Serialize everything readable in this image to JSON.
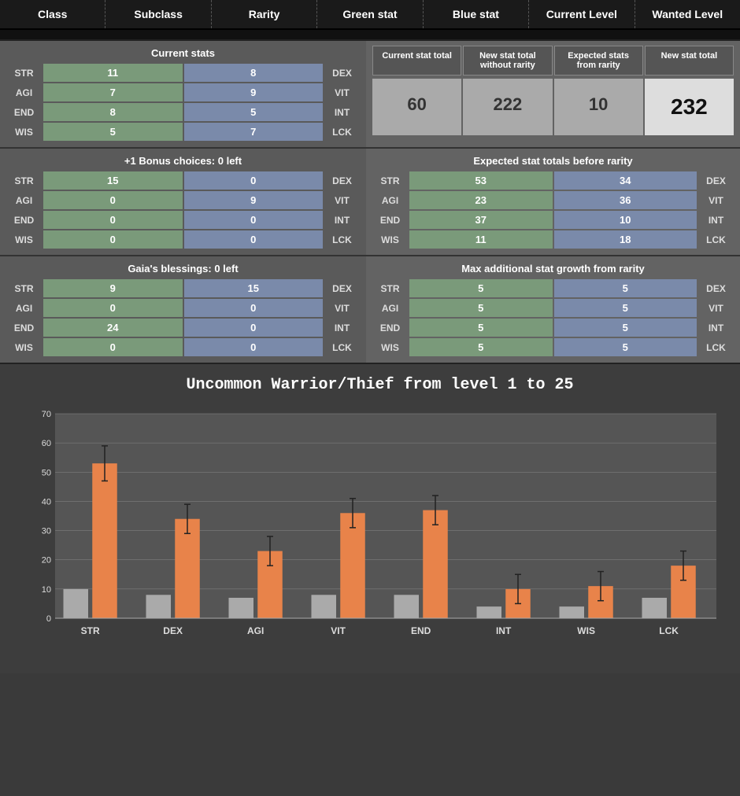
{
  "header": {
    "class_label": "Class",
    "subclass_label": "Subclass",
    "rarity_label": "Rarity",
    "green_stat_label": "Green stat",
    "blue_stat_label": "Blue stat",
    "current_level_label": "Current Level",
    "wanted_level_label": "Wanted Level"
  },
  "current_stats": {
    "title": "Current stats",
    "rows": [
      {
        "label_left": "STR",
        "green": "11",
        "blue": "8",
        "label_right": "DEX"
      },
      {
        "label_left": "AGI",
        "green": "7",
        "blue": "9",
        "label_right": "VIT"
      },
      {
        "label_left": "END",
        "green": "8",
        "blue": "5",
        "label_right": "INT"
      },
      {
        "label_left": "WIS",
        "green": "5",
        "blue": "7",
        "label_right": "LCK"
      }
    ]
  },
  "summary": {
    "col1_header": "Current stat total",
    "col2_header": "New stat total without rarity",
    "col3_header": "Expected stats from rarity",
    "col4_header": "New stat total",
    "col1_value": "60",
    "col2_value": "222",
    "col3_value": "10",
    "col4_value": "232"
  },
  "bonus": {
    "title": "+1 Bonus choices: 0 left",
    "rows": [
      {
        "label_left": "STR",
        "green": "15",
        "blue": "0",
        "label_right": "DEX"
      },
      {
        "label_left": "AGI",
        "green": "0",
        "blue": "9",
        "label_right": "VIT"
      },
      {
        "label_left": "END",
        "green": "0",
        "blue": "0",
        "label_right": "INT"
      },
      {
        "label_left": "WIS",
        "green": "0",
        "blue": "0",
        "label_right": "LCK"
      }
    ]
  },
  "expected_before_rarity": {
    "title": "Expected stat totals before rarity",
    "rows": [
      {
        "label_left": "STR",
        "green": "53",
        "blue": "34",
        "label_right": "DEX"
      },
      {
        "label_left": "AGI",
        "green": "23",
        "blue": "36",
        "label_right": "VIT"
      },
      {
        "label_left": "END",
        "green": "37",
        "blue": "10",
        "label_right": "INT"
      },
      {
        "label_left": "WIS",
        "green": "11",
        "blue": "18",
        "label_right": "LCK"
      }
    ]
  },
  "gaias": {
    "title": "Gaia's blessings: 0 left",
    "rows": [
      {
        "label_left": "STR",
        "green": "9",
        "blue": "15",
        "label_right": "DEX"
      },
      {
        "label_left": "AGI",
        "green": "0",
        "blue": "0",
        "label_right": "VIT"
      },
      {
        "label_left": "END",
        "green": "24",
        "blue": "0",
        "label_right": "INT"
      },
      {
        "label_left": "WIS",
        "green": "0",
        "blue": "0",
        "label_right": "LCK"
      }
    ]
  },
  "max_additional": {
    "title": "Max additional stat growth from rarity",
    "rows": [
      {
        "label_left": "STR",
        "green": "5",
        "blue": "5",
        "label_right": "DEX"
      },
      {
        "label_left": "AGI",
        "green": "5",
        "blue": "5",
        "label_right": "VIT"
      },
      {
        "label_left": "END",
        "green": "5",
        "blue": "5",
        "label_right": "INT"
      },
      {
        "label_left": "WIS",
        "green": "5",
        "blue": "5",
        "label_right": "LCK"
      }
    ]
  },
  "chart": {
    "title": "Uncommon  Warrior/Thief  from level 1 to 25",
    "y_labels": [
      "70",
      "60",
      "50",
      "40",
      "30",
      "20",
      "10",
      "0"
    ],
    "x_labels": [
      "STR",
      "DEX",
      "AGI",
      "VIT",
      "END",
      "INT",
      "WIS",
      "LCK"
    ],
    "gray_bars": [
      10,
      8,
      7,
      8,
      8,
      4,
      4,
      7
    ],
    "orange_bars": [
      53,
      34,
      23,
      36,
      37,
      10,
      11,
      18
    ],
    "error_bars": [
      6,
      5,
      5,
      5,
      5,
      5,
      5,
      5
    ]
  }
}
